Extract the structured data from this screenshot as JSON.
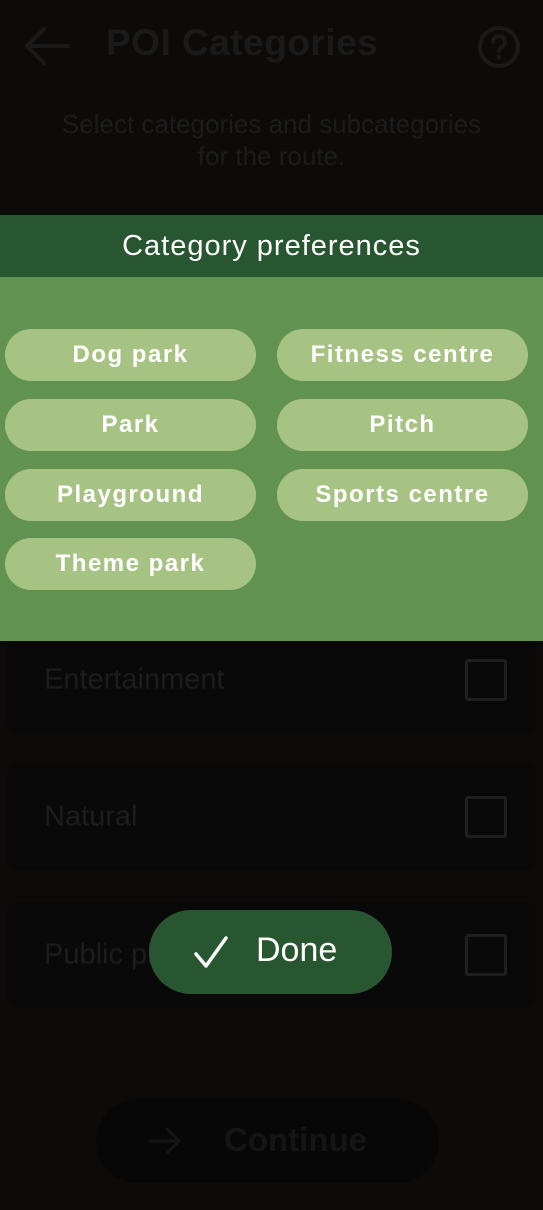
{
  "header": {
    "title": "POI Categories",
    "back_icon": "arrow-left-icon",
    "help_icon": "help-circle-icon"
  },
  "subtitle": "Select categories and subcategories for the route.",
  "categories": [
    {
      "label": "Entertainment",
      "checked": false
    },
    {
      "label": "Natural",
      "checked": false
    },
    {
      "label": "Public places",
      "checked": false
    }
  ],
  "continue_button": {
    "label": "Continue",
    "icon": "arrow-right-icon"
  },
  "dialog": {
    "title": "Category preferences",
    "chips": [
      "Dog park",
      "Fitness centre",
      "Park",
      "Pitch",
      "Playground",
      "Sports centre",
      "Theme park"
    ],
    "done_button": {
      "label": "Done",
      "icon": "check-icon"
    }
  },
  "colors": {
    "dialog_header": "#285630",
    "dialog_body": "#62924f",
    "chip": "#a7c384",
    "done_button": "#285630"
  }
}
